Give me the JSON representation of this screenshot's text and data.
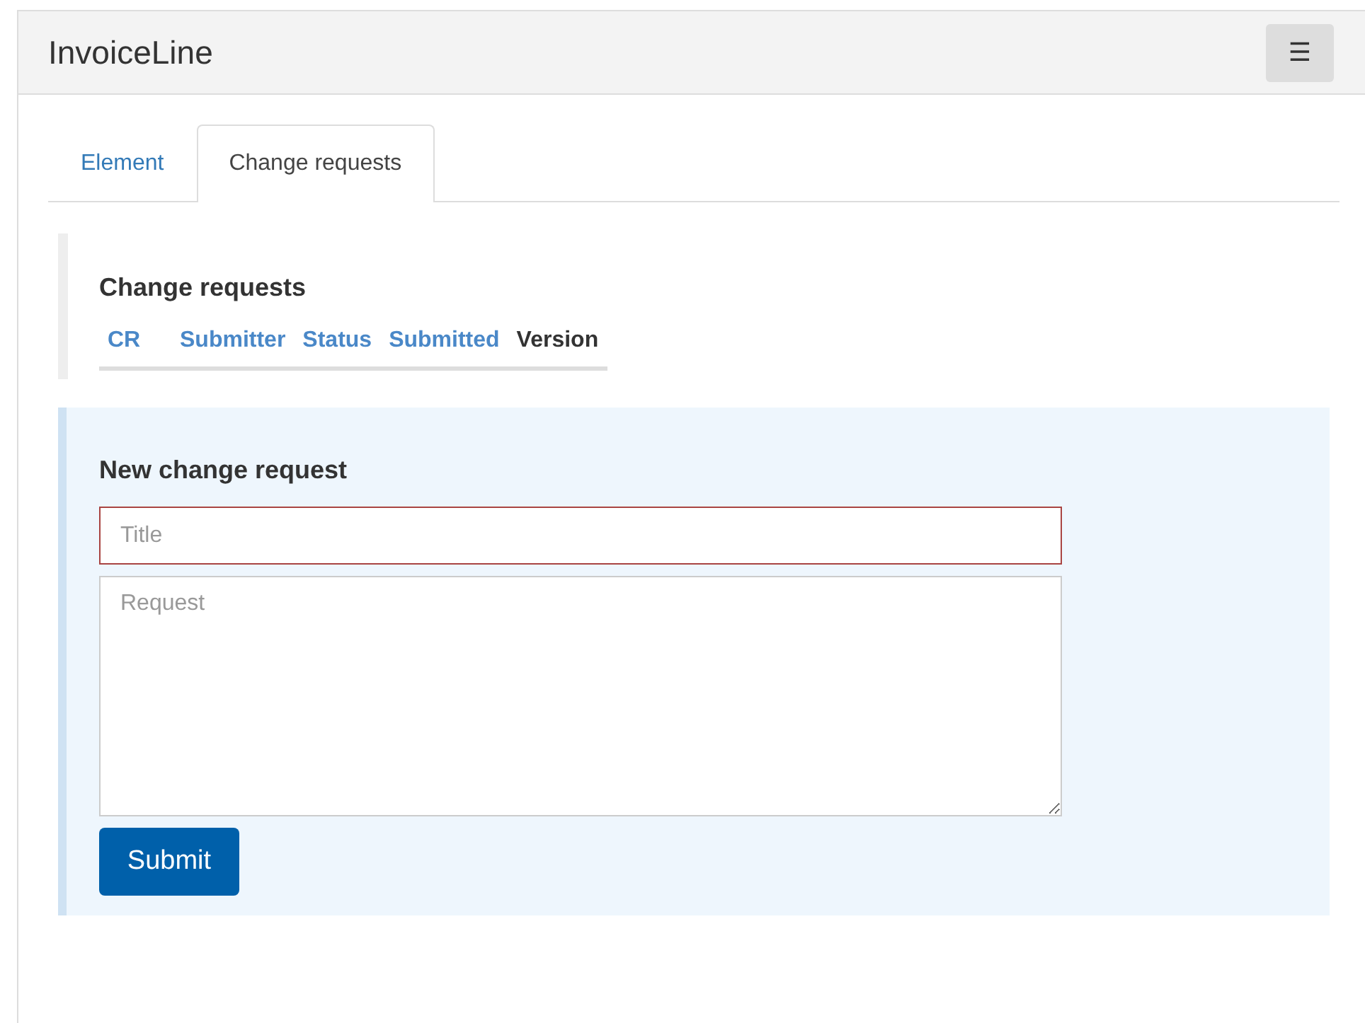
{
  "header": {
    "title": "InvoiceLine",
    "menu_button": "☰"
  },
  "tabs": [
    {
      "label": "Element",
      "selected": false
    },
    {
      "label": "Change requests",
      "selected": true
    }
  ],
  "change_requests": {
    "heading": "Change requests",
    "columns": [
      {
        "label": "CR",
        "sortable": true
      },
      {
        "label": "Submitter",
        "sortable": true
      },
      {
        "label": "Status",
        "sortable": true
      },
      {
        "label": "Submitted",
        "sortable": true
      },
      {
        "label": "Version",
        "sortable": false
      }
    ]
  },
  "new_request": {
    "heading": "New change request",
    "title_field": {
      "placeholder": "Title",
      "invalid": true
    },
    "request_field": {
      "placeholder": "Request"
    },
    "submit": "Submit"
  }
}
